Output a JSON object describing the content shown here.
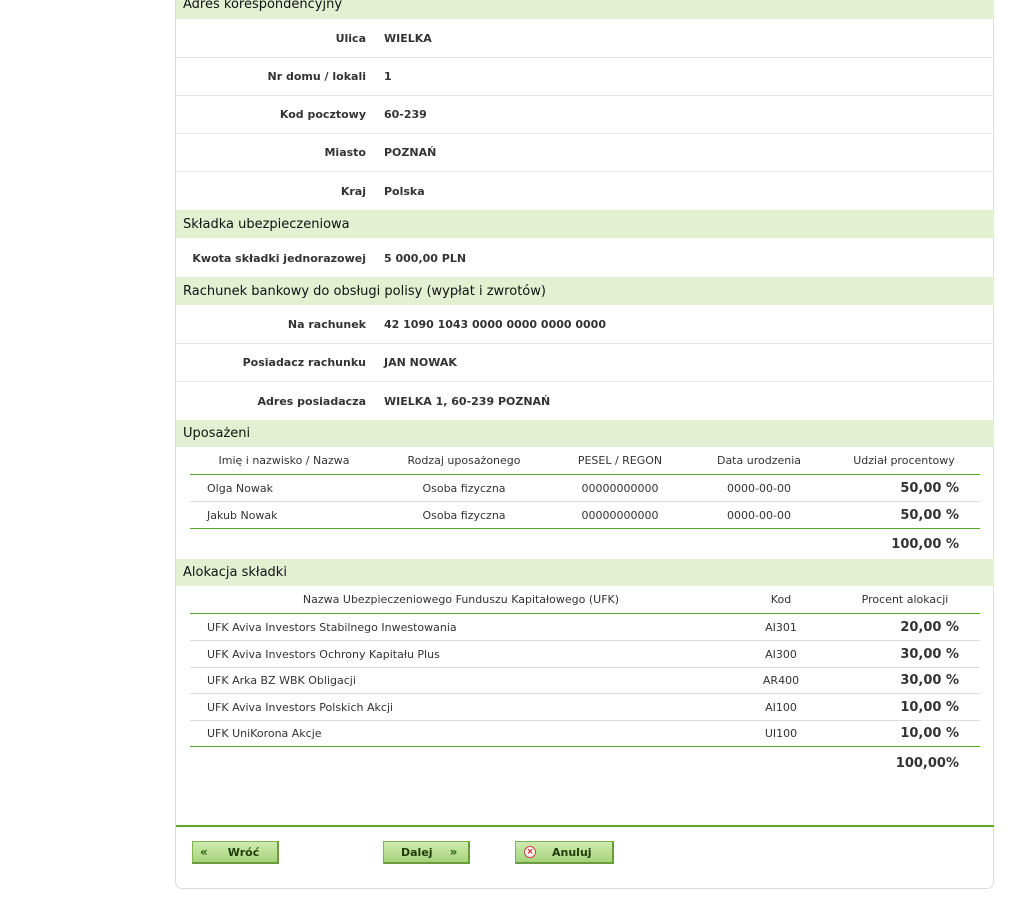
{
  "sections": {
    "address": {
      "title": "Adres korespondencyjny",
      "rows": [
        {
          "label": "Ulica",
          "value": "WIELKA"
        },
        {
          "label": "Nr domu / lokali",
          "value": "1"
        },
        {
          "label": "Kod pocztowy",
          "value": "60-239"
        },
        {
          "label": "Miasto",
          "value": "POZNAŃ"
        },
        {
          "label": "Kraj",
          "value": "Polska"
        }
      ]
    },
    "premium": {
      "title": "Składka ubezpieczeniowa",
      "rows": [
        {
          "label": "Kwota składki jednorazowej",
          "value": "5 000,00 PLN"
        }
      ]
    },
    "bank": {
      "title": "Rachunek bankowy do obsługi polisy (wypłat i zwrotów)",
      "rows": [
        {
          "label": "Na rachunek",
          "value": "42 1090 1043 0000 0000 0000 0000"
        },
        {
          "label": "Posiadacz rachunku",
          "value": "JAN NOWAK"
        },
        {
          "label": "Adres posiadacza",
          "value": "WIELKA 1, 60-239 POZNAŃ"
        }
      ]
    },
    "beneficiaries": {
      "title": "Uposażeni",
      "headers": [
        "Imię i nazwisko / Nazwa",
        "Rodzaj uposażonego",
        "PESEL / REGON",
        "Data urodzenia",
        "Udział procentowy"
      ],
      "rows": [
        [
          "Olga Nowak",
          "Osoba fizyczna",
          "00000000000",
          "0000-00-00",
          "50,00 %"
        ],
        [
          "Jakub Nowak",
          "Osoba fizyczna",
          "00000000000",
          "0000-00-00",
          "50,00 %"
        ]
      ],
      "total": "100,00 %"
    },
    "allocation": {
      "title": "Alokacja składki",
      "headers": [
        "Nazwa Ubezpieczeniowego Funduszu Kapitałowego (UFK)",
        "Kod",
        "Procent alokacji"
      ],
      "rows": [
        [
          "UFK Aviva Investors Stabilnego Inwestowania",
          "AI301",
          "20,00 %"
        ],
        [
          "UFK Aviva Investors Ochrony Kapitału Plus",
          "AI300",
          "30,00 %"
        ],
        [
          "UFK Arka BZ WBK Obligacji",
          "AR400",
          "30,00 %"
        ],
        [
          "UFK Aviva Investors Polskich Akcji",
          "AI100",
          "10,00 %"
        ],
        [
          "UFK UniKorona Akcje",
          "UI100",
          "10,00 %"
        ]
      ],
      "total": "100,00%"
    }
  },
  "buttons": {
    "back": {
      "label": "Wróć",
      "icon": "double-chevron-left-icon"
    },
    "next": {
      "label": "Dalej",
      "icon": "double-chevron-right-icon"
    },
    "cancel": {
      "label": "Anuluj",
      "icon": "cancel-circle-icon"
    }
  },
  "colors": {
    "section_bg": "#e3f0d2",
    "accent": "#5aaa2a",
    "button": "#a6d479"
  }
}
